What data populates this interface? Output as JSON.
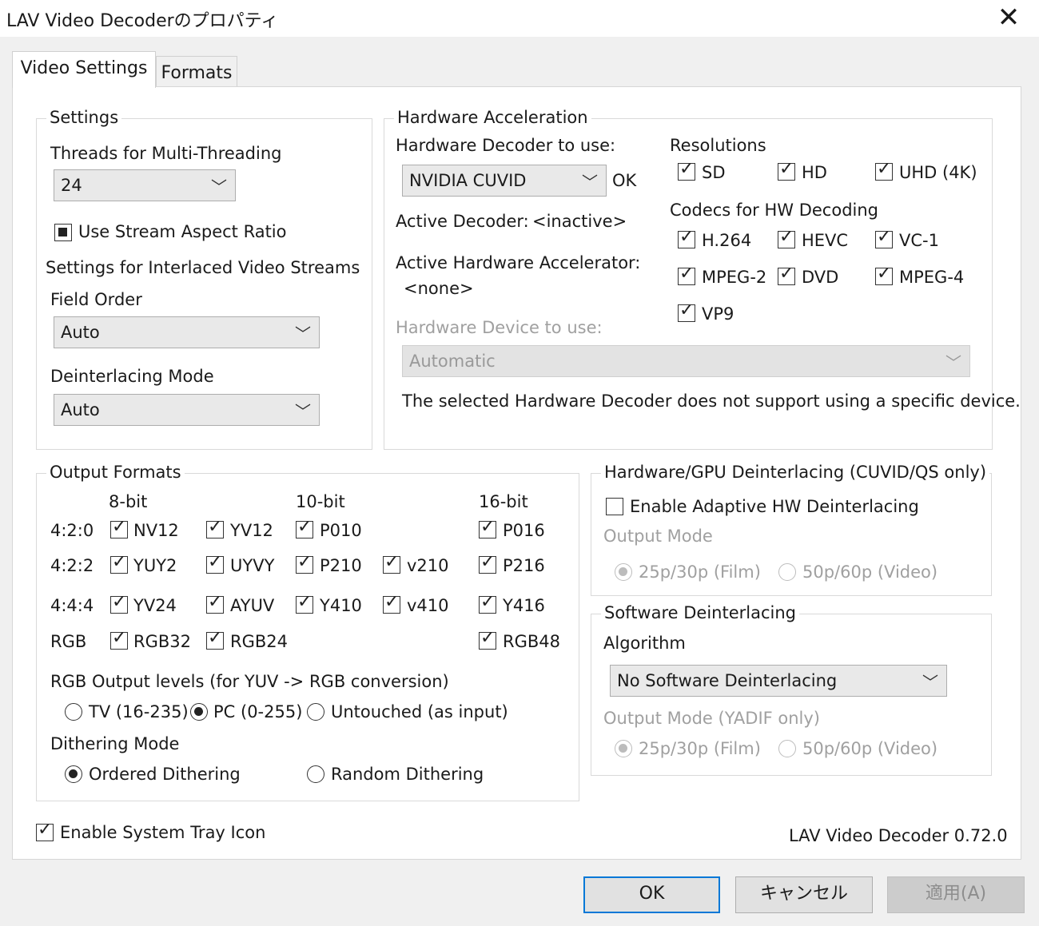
{
  "window": {
    "title": "LAV Video Decoderのプロパティ",
    "close_glyph": "✕"
  },
  "tabs": [
    {
      "label": "Video Settings",
      "active": true
    },
    {
      "label": "Formats",
      "active": false
    }
  ],
  "settings": {
    "group_label": "Settings",
    "threads_label": "Threads for Multi-Threading",
    "threads_value": "24",
    "use_stream_aspect_label": "Use Stream Aspect Ratio",
    "interlaced_label": "Settings for Interlaced Video Streams",
    "field_order_label": "Field Order",
    "field_order_value": "Auto",
    "deinterlacing_mode_label": "Deinterlacing Mode",
    "deinterlacing_mode_value": "Auto"
  },
  "hwaccel": {
    "group_label": "Hardware Acceleration",
    "decoder_label": "Hardware Decoder to use:",
    "decoder_value": "NVIDIA CUVID",
    "decoder_status": "OK",
    "active_decoder_label": "Active Decoder:",
    "active_decoder_value": "<inactive>",
    "active_accel_label": "Active Hardware Accelerator:",
    "active_accel_value": "<none>",
    "device_label": "Hardware Device to use:",
    "device_value": "Automatic",
    "device_note": "The selected Hardware Decoder does not support using a specific device.",
    "resolutions_label": "Resolutions",
    "res_sd": "SD",
    "res_hd": "HD",
    "res_uhd": "UHD (4K)",
    "codecs_label": "Codecs for HW Decoding",
    "codec_h264": "H.264",
    "codec_hevc": "HEVC",
    "codec_vc1": "VC-1",
    "codec_mpeg2": "MPEG-2",
    "codec_dvd": "DVD",
    "codec_mpeg4": "MPEG-4",
    "codec_vp9": "VP9"
  },
  "output": {
    "group_label": "Output Formats",
    "col_8bit": "8-bit",
    "col_10bit": "10-bit",
    "col_16bit": "16-bit",
    "row_420": "4:2:0",
    "row_422": "4:2:2",
    "row_444": "4:4:4",
    "row_rgb": "RGB",
    "nv12": "NV12",
    "yv12": "YV12",
    "p010": "P010",
    "p016": "P016",
    "yuy2": "YUY2",
    "uyvy": "UYVY",
    "p210": "P210",
    "v210": "v210",
    "p216": "P216",
    "yv24": "YV24",
    "ayuv": "AYUV",
    "y410": "Y410",
    "v410": "v410",
    "y416": "Y416",
    "rgb32": "RGB32",
    "rgb24": "RGB24",
    "rgb48": "RGB48",
    "levels_label": "RGB Output levels (for YUV -> RGB conversion)",
    "levels_tv": "TV (16-235)",
    "levels_pc": "PC (0-255)",
    "levels_untouched": "Untouched (as input)",
    "dither_label": "Dithering Mode",
    "dither_ordered": "Ordered Dithering",
    "dither_random": "Random Dithering"
  },
  "hwdeint": {
    "group_label": "Hardware/GPU Deinterlacing (CUVID/QS only)",
    "enable_label": "Enable Adaptive HW Deinterlacing",
    "output_mode_label": "Output Mode",
    "film": "25p/30p (Film)",
    "video": "50p/60p (Video)"
  },
  "swdeint": {
    "group_label": "Software Deinterlacing",
    "algorithm_label": "Algorithm",
    "algorithm_value": "No Software Deinterlacing",
    "output_mode_label": "Output Mode (YADIF only)",
    "film": "25p/30p (Film)",
    "video": "50p/60p (Video)"
  },
  "footer": {
    "tray_label": "Enable System Tray Icon",
    "version": "LAV Video Decoder 0.72.0"
  },
  "buttons": {
    "ok": "OK",
    "cancel": "キャンセル",
    "apply": "適用(A)"
  }
}
